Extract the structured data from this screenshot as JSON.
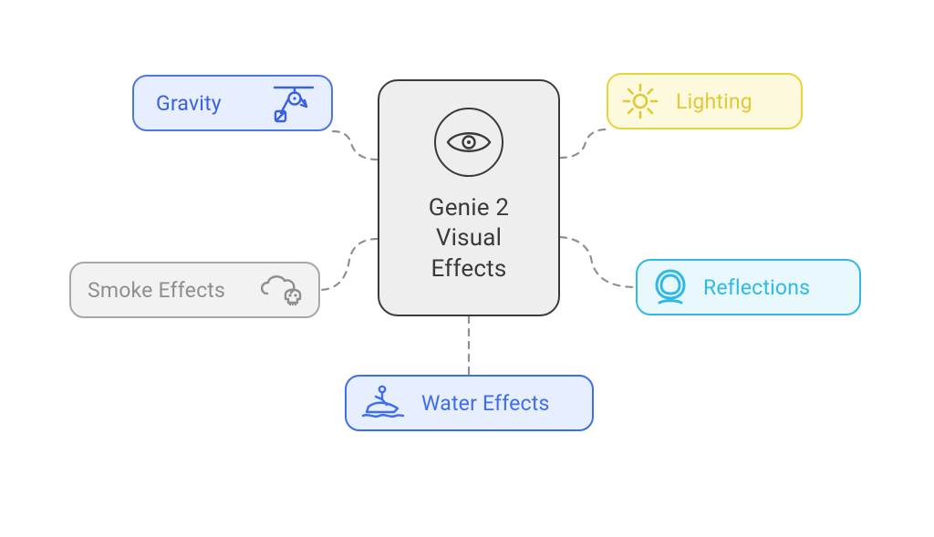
{
  "center": {
    "title_line1": "Genie 2",
    "title_line2": "Visual",
    "title_line3": "Effects"
  },
  "nodes": {
    "gravity": {
      "label": "Gravity"
    },
    "lighting": {
      "label": "Lighting"
    },
    "smoke": {
      "label": "Smoke Effects"
    },
    "reflections": {
      "label": "Reflections"
    },
    "water": {
      "label": "Water Effects"
    }
  }
}
